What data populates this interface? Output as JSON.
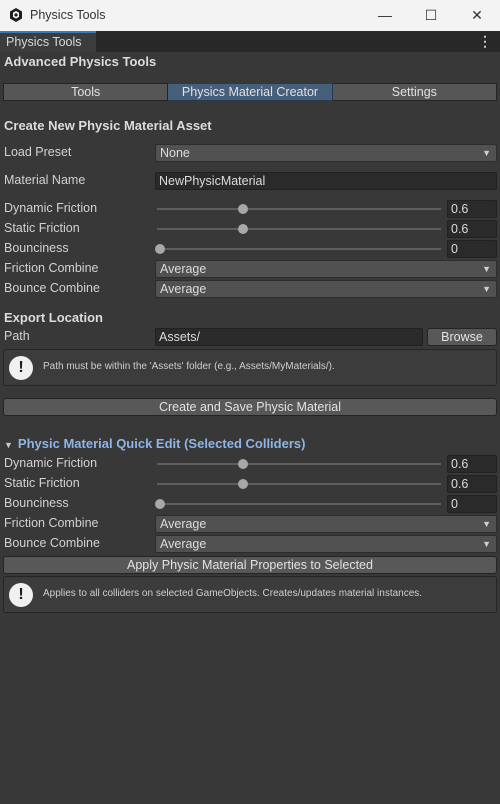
{
  "window": {
    "title": "Physics Tools",
    "app_icon": "unity-logo-icon"
  },
  "tab": {
    "label": "Physics Tools"
  },
  "header": {
    "title": "Advanced Physics Tools"
  },
  "toolbar": {
    "tabs": [
      "Tools",
      "Physics Material Creator",
      "Settings"
    ],
    "active": "Physics Material Creator"
  },
  "create": {
    "section_title": "Create New Physic Material Asset",
    "load_preset": {
      "label": "Load Preset",
      "value": "None"
    },
    "material_name": {
      "label": "Material Name",
      "value": "NewPhysicMaterial"
    },
    "dynamic_friction": {
      "label": "Dynamic Friction",
      "value": "0.6"
    },
    "static_friction": {
      "label": "Static Friction",
      "value": "0.6"
    },
    "bounciness": {
      "label": "Bounciness",
      "value": "0"
    },
    "friction_combine": {
      "label": "Friction Combine",
      "value": "Average"
    },
    "bounce_combine": {
      "label": "Bounce Combine",
      "value": "Average"
    }
  },
  "export": {
    "section_title": "Export Location",
    "path_label": "Path",
    "path_value": "Assets/",
    "browse_label": "Browse",
    "help": "Path must be within the 'Assets' folder (e.g., Assets/MyMaterials/).",
    "create_button": "Create and Save Physic Material"
  },
  "quick_edit": {
    "title": "Physic Material Quick Edit (Selected Colliders)",
    "dynamic_friction": {
      "label": "Dynamic Friction",
      "value": "0.6"
    },
    "static_friction": {
      "label": "Static Friction",
      "value": "0.6"
    },
    "bounciness": {
      "label": "Bounciness",
      "value": "0"
    },
    "friction_combine": {
      "label": "Friction Combine",
      "value": "Average"
    },
    "bounce_combine": {
      "label": "Bounce Combine",
      "value": "Average"
    },
    "apply_button": "Apply Physic Material Properties to Selected",
    "help": "Applies to all colliders on selected GameObjects. Creates/updates material instances."
  },
  "colors": {
    "background": "#383838",
    "active_tab": "#46607c",
    "foldout_title": "#8fb4e6",
    "tab_accent": "#3a79bb"
  }
}
